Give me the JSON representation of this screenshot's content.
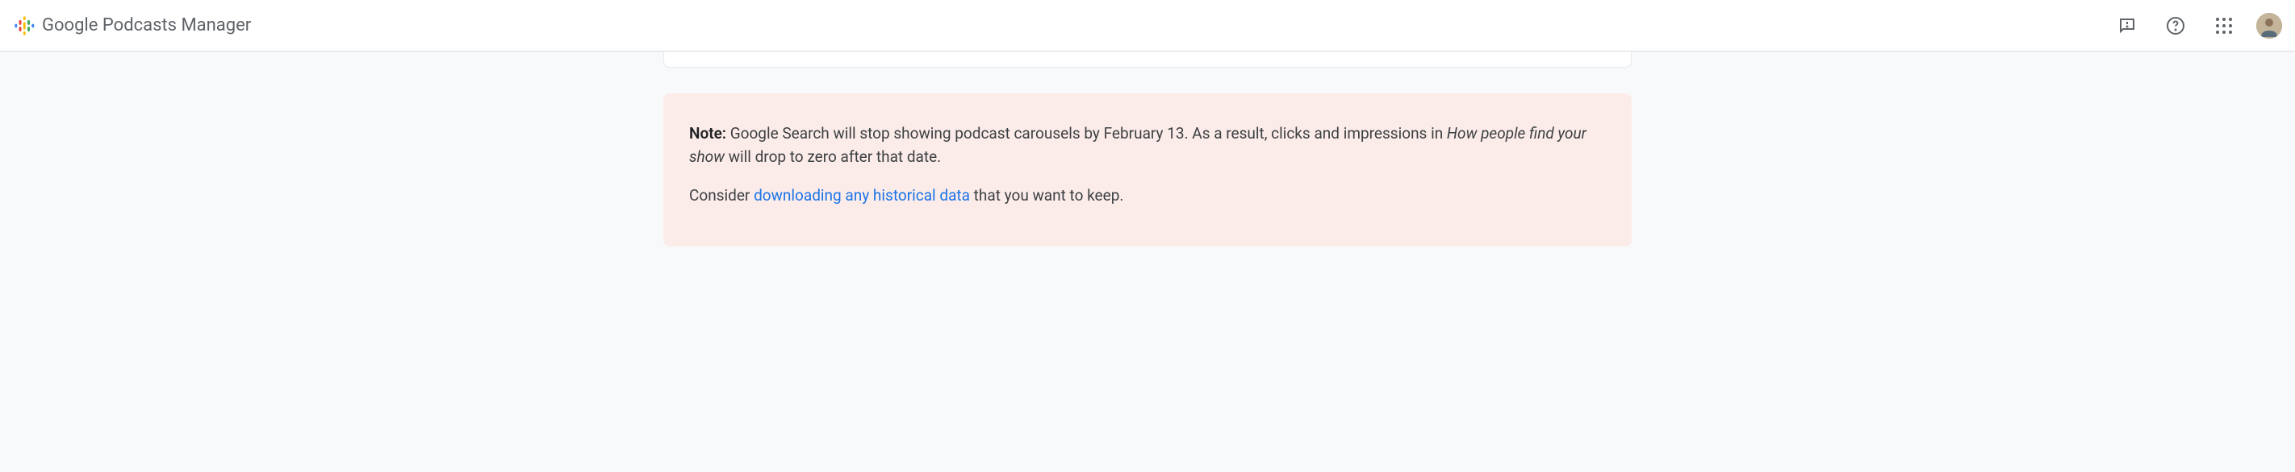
{
  "header": {
    "app_title": "Google Podcasts Manager"
  },
  "notice": {
    "note_label": "Note:",
    "line1_part1": " Google Search will stop showing podcast carousels by February 13. As a result, clicks and impressions in ",
    "line1_italic": "How people find your show",
    "line1_part2": " will drop to zero after that date.",
    "line2_part1": "Consider ",
    "line2_link": "downloading any historical data",
    "line2_part2": " that you want to keep."
  }
}
